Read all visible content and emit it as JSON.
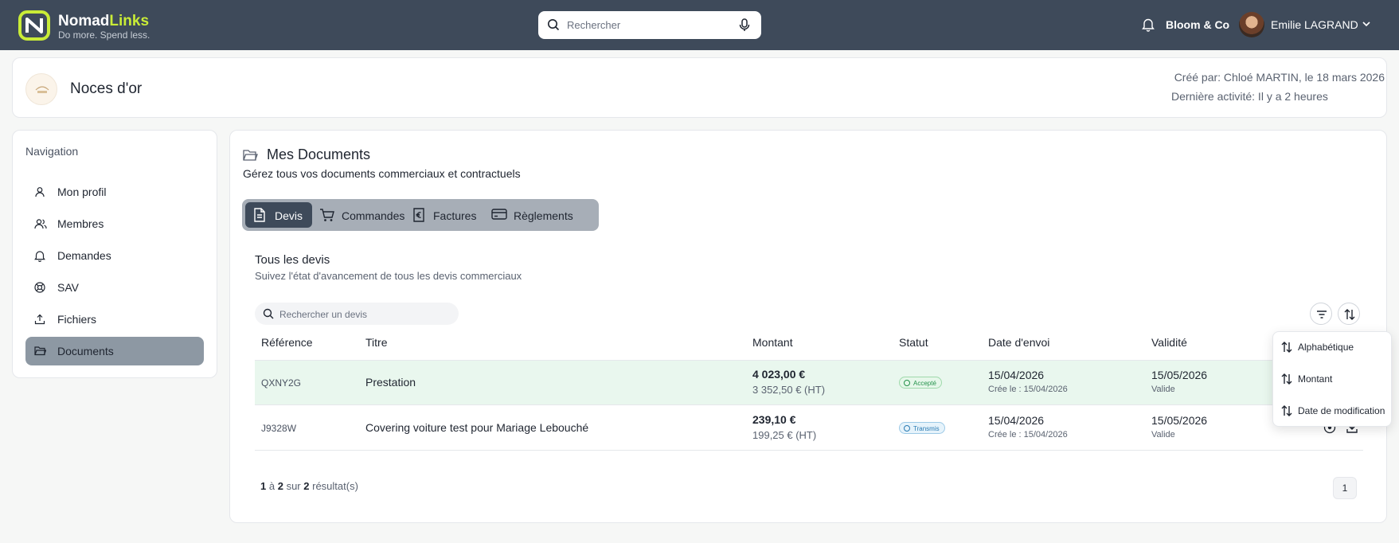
{
  "header": {
    "brand_main": "Nomad",
    "brand_accent": "Links",
    "tagline": "Do more. Spend less.",
    "search_placeholder": "Rechercher",
    "company": "Bloom & Co",
    "user_name": "Emilie LAGRAND",
    "accent_color": "#c9ec37",
    "bar_color": "#3e4a5a"
  },
  "project": {
    "title": "Noces d'or",
    "created_by": "Créé par: Chloé MARTIN, le 18 mars 2026",
    "last_activity": "Dernière activité: Il y a 2 heures"
  },
  "sidebar": {
    "title": "Navigation",
    "items": [
      {
        "label": "Mon profil",
        "icon": "user-icon"
      },
      {
        "label": "Membres",
        "icon": "users-icon"
      },
      {
        "label": "Demandes",
        "icon": "bell-icon"
      },
      {
        "label": "SAV",
        "icon": "lifebuoy-icon"
      },
      {
        "label": "Fichiers",
        "icon": "upload-icon"
      },
      {
        "label": "Documents",
        "icon": "folder-icon",
        "active": true
      }
    ]
  },
  "documents": {
    "title": "Mes Documents",
    "subtitle": "Gérez tous vos documents commerciaux et contractuels",
    "tabs": [
      {
        "label": "Devis",
        "icon": "document-icon",
        "active": true
      },
      {
        "label": "Commandes",
        "icon": "cart-icon"
      },
      {
        "label": "Factures",
        "icon": "euro-invoice-icon"
      },
      {
        "label": "Règlements",
        "icon": "credit-card-icon"
      }
    ],
    "section_title": "Tous les devis",
    "section_subtitle": "Suivez l'état d'avancement de tous les devis commerciaux",
    "search_placeholder": "Rechercher un devis",
    "columns": [
      "Référence",
      "Titre",
      "Montant",
      "Statut",
      "Date d'envoi",
      "Validité"
    ],
    "rows": [
      {
        "reference": "QXNY2G",
        "title": "Prestation",
        "amount_ttc": "4 023,00 €",
        "amount_ht": "3 352,50 € (HT)",
        "status": "Accepté",
        "sent_date": "15/04/2026",
        "created": "Crée le : 15/04/2026",
        "validity_date": "15/05/2026",
        "validity_label": "Valide"
      },
      {
        "reference": "J9328W",
        "title": "Covering voiture test pour Mariage Lebouché",
        "amount_ttc": "239,10 €",
        "amount_ht": "199,25 € (HT)",
        "status": "Transmis",
        "sent_date": "15/04/2026",
        "created": "Crée le : 15/04/2026",
        "validity_date": "15/05/2026",
        "validity_label": "Valide"
      }
    ],
    "pagination": {
      "from": "1",
      "to_word": "à",
      "to": "2",
      "of_word": "sur",
      "total": "2",
      "suffix": "résultat(s)",
      "current_page": "1"
    },
    "sort_menu": [
      "Alphabétique",
      "Montant",
      "Date de modification"
    ]
  }
}
